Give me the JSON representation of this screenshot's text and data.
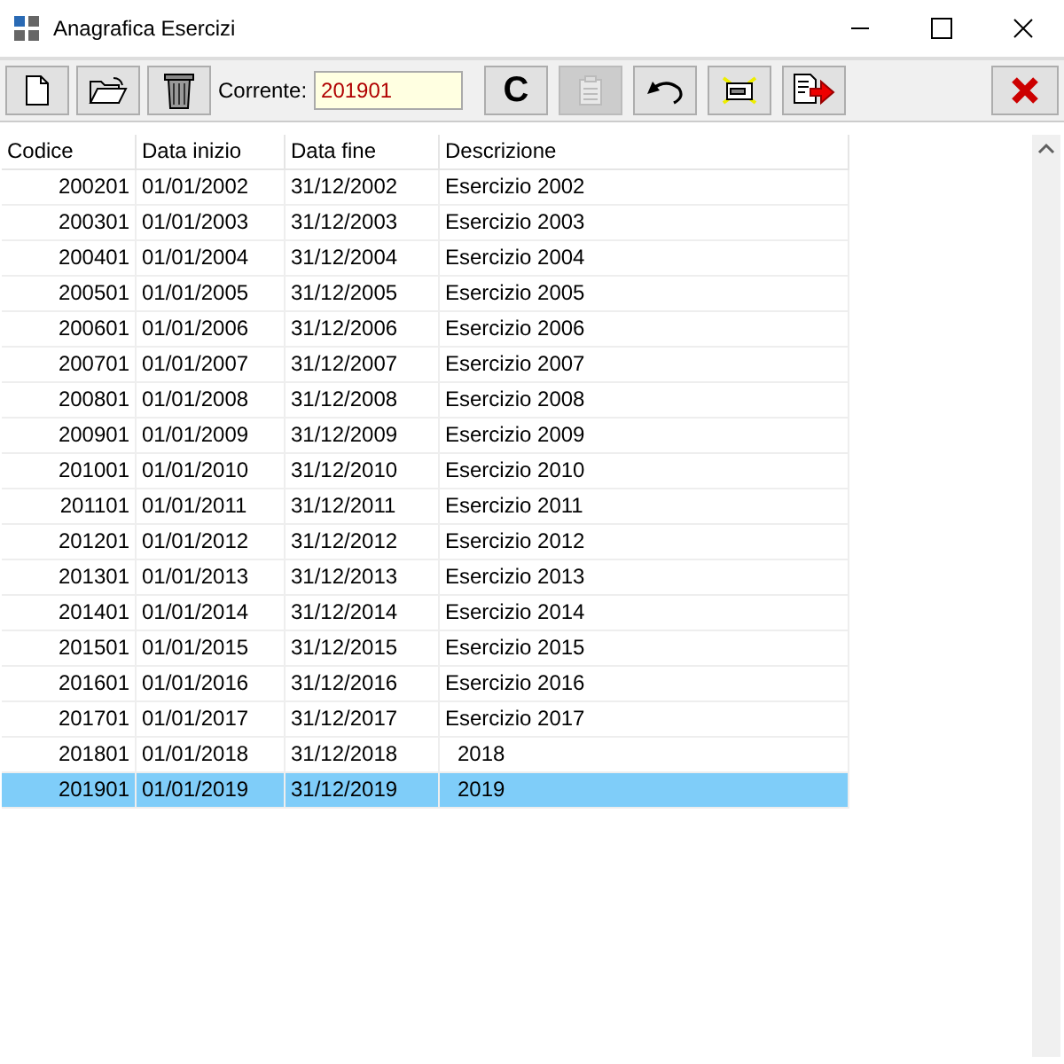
{
  "window": {
    "title": "Anagrafica Esercizi"
  },
  "toolbar": {
    "buttons": [
      {
        "kind": "new",
        "disabled": false
      },
      {
        "kind": "open",
        "disabled": false
      },
      {
        "kind": "delete",
        "disabled": false
      }
    ],
    "current_label": "Corrente:",
    "current_value": "201901",
    "buttons_right": [
      {
        "kind": "text",
        "label": "C",
        "disabled": false
      },
      {
        "kind": "paste",
        "disabled": true
      },
      {
        "kind": "undo",
        "disabled": false
      },
      {
        "kind": "highlight",
        "disabled": false
      },
      {
        "kind": "export",
        "disabled": false
      }
    ],
    "close": {
      "kind": "close",
      "disabled": false
    }
  },
  "table": {
    "columns": [
      "Codice",
      "Data inizio",
      "Data fine",
      "Descrizione"
    ],
    "rows": [
      {
        "cells": [
          "200201",
          "01/01/2002",
          "31/12/2002",
          "Esercizio 2002"
        ],
        "selected": false
      },
      {
        "cells": [
          "200301",
          "01/01/2003",
          "31/12/2003",
          "Esercizio 2003"
        ],
        "selected": false
      },
      {
        "cells": [
          "200401",
          "01/01/2004",
          "31/12/2004",
          "Esercizio 2004"
        ],
        "selected": false
      },
      {
        "cells": [
          "200501",
          "01/01/2005",
          "31/12/2005",
          "Esercizio 2005"
        ],
        "selected": false
      },
      {
        "cells": [
          "200601",
          "01/01/2006",
          "31/12/2006",
          "Esercizio 2006"
        ],
        "selected": false
      },
      {
        "cells": [
          "200701",
          "01/01/2007",
          "31/12/2007",
          "Esercizio 2007"
        ],
        "selected": false
      },
      {
        "cells": [
          "200801",
          "01/01/2008",
          "31/12/2008",
          "Esercizio 2008"
        ],
        "selected": false
      },
      {
        "cells": [
          "200901",
          "01/01/2009",
          "31/12/2009",
          "Esercizio 2009"
        ],
        "selected": false
      },
      {
        "cells": [
          "201001",
          "01/01/2010",
          "31/12/2010",
          "Esercizio 2010"
        ],
        "selected": false
      },
      {
        "cells": [
          "201101",
          "01/01/2011",
          "31/12/2011",
          "Esercizio 2011"
        ],
        "selected": false
      },
      {
        "cells": [
          "201201",
          "01/01/2012",
          "31/12/2012",
          "Esercizio 2012"
        ],
        "selected": false
      },
      {
        "cells": [
          "201301",
          "01/01/2013",
          "31/12/2013",
          "Esercizio 2013"
        ],
        "selected": false
      },
      {
        "cells": [
          "201401",
          "01/01/2014",
          "31/12/2014",
          "Esercizio 2014"
        ],
        "selected": false
      },
      {
        "cells": [
          "201501",
          "01/01/2015",
          "31/12/2015",
          "Esercizio 2015"
        ],
        "selected": false
      },
      {
        "cells": [
          "201601",
          "01/01/2016",
          "31/12/2016",
          "Esercizio 2016"
        ],
        "selected": false
      },
      {
        "cells": [
          "201701",
          "01/01/2017",
          "31/12/2017",
          "Esercizio 2017"
        ],
        "selected": false
      },
      {
        "cells": [
          "201801",
          "01/01/2018",
          "31/12/2018",
          "2018"
        ],
        "selected": false
      },
      {
        "cells": [
          "201901",
          "01/01/2019",
          "31/12/2019",
          "2019"
        ],
        "selected": true
      }
    ]
  }
}
